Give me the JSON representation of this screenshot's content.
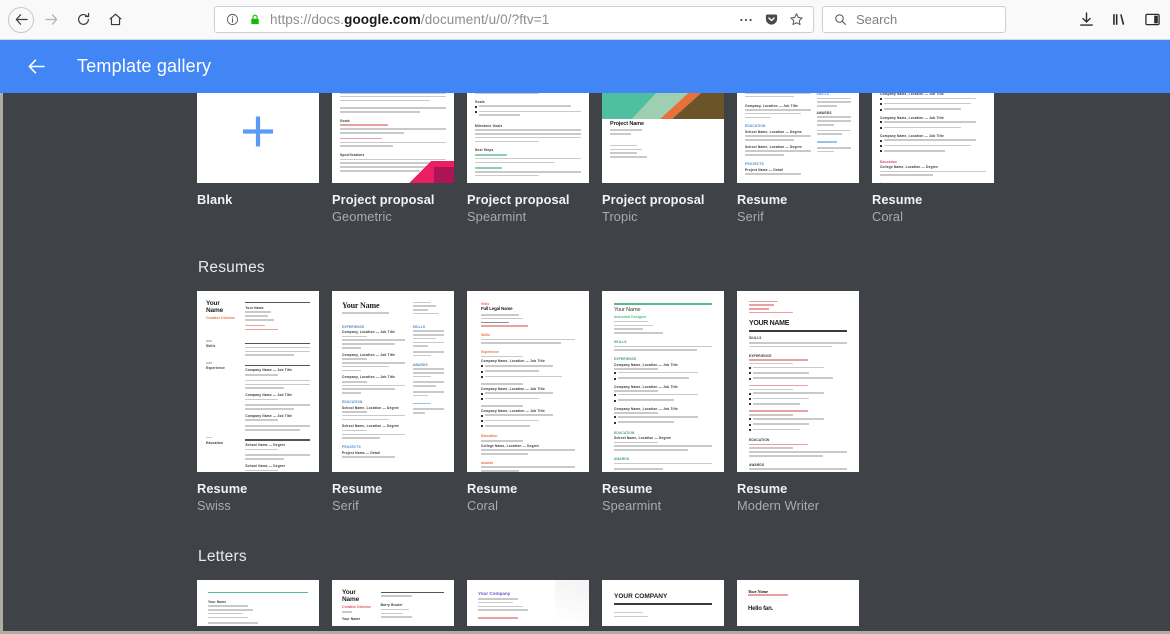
{
  "browser": {
    "nav": {
      "back_icon": "arrow-left-icon",
      "forward_icon": "arrow-right-icon",
      "reload_icon": "reload-icon",
      "home_icon": "home-icon"
    },
    "url": {
      "scheme": "https://",
      "prefix": "docs.",
      "host": "google.com",
      "path": "/document/u/0/?ftv=1",
      "full": "https://docs.google.com/document/u/0/?ftv=1",
      "info_icon": "page-info-icon",
      "lock_icon": "lock-icon",
      "page_actions_icon": "ellipsis-icon",
      "pocket_icon": "pocket-icon",
      "bookmark_icon": "star-icon"
    },
    "search": {
      "placeholder": "Search",
      "icon": "search-icon"
    },
    "toolbar_right": {
      "downloads_icon": "download-icon",
      "library_icon": "library-icon",
      "sidebar_icon": "sidebar-icon"
    }
  },
  "app_header": {
    "back_icon": "arrow-left-icon",
    "title": "Template gallery",
    "accent_color": "#4285f4"
  },
  "gallery": {
    "background_color": "#3f4348",
    "rows": [
      {
        "section": null,
        "cards": [
          {
            "title": "Blank",
            "subtitle": "",
            "style": "blank"
          },
          {
            "title": "Project proposal",
            "subtitle": "Geometric",
            "style": "geometric"
          },
          {
            "title": "Project proposal",
            "subtitle": "Spearmint",
            "style": "proposal-spearmint"
          },
          {
            "title": "Project proposal",
            "subtitle": "Tropic",
            "style": "tropic"
          },
          {
            "title": "Resume",
            "subtitle": "Serif",
            "style": "resume-serif-top"
          },
          {
            "title": "Resume",
            "subtitle": "Coral",
            "style": "resume-coral-top"
          }
        ]
      },
      {
        "section": "Resumes",
        "cards": [
          {
            "title": "Resume",
            "subtitle": "Swiss",
            "style": "swiss",
            "name": "Your Name",
            "role": "Creative Director"
          },
          {
            "title": "Resume",
            "subtitle": "Serif",
            "style": "serif",
            "name": "Your Name",
            "role": ""
          },
          {
            "title": "Resume",
            "subtitle": "Coral",
            "style": "coral",
            "name": "Full Legal Name",
            "role": "Hello"
          },
          {
            "title": "Resume",
            "subtitle": "Spearmint",
            "style": "spearmint",
            "name": "Your Name",
            "role": "Industrial Designer"
          },
          {
            "title": "Resume",
            "subtitle": "Modern Writer",
            "style": "modern",
            "name": "YOUR NAME",
            "role": ""
          }
        ]
      },
      {
        "section": "Letters",
        "cards": [
          {
            "title": "",
            "subtitle": "",
            "style": "letter-mint",
            "name": "Your Name"
          },
          {
            "title": "",
            "subtitle": "",
            "style": "letter-swiss",
            "name": "Your Name",
            "role": "Creative Director"
          },
          {
            "title": "",
            "subtitle": "",
            "style": "letter-plum",
            "name": "Your Company"
          },
          {
            "title": "",
            "subtitle": "",
            "style": "letter-company",
            "name": "YOUR COMPANY"
          },
          {
            "title": "",
            "subtitle": "",
            "style": "letter-fan",
            "name": "Your Name",
            "role": "Hello fan."
          }
        ]
      }
    ],
    "section_titles": {
      "resumes": "Resumes",
      "letters": "Letters"
    },
    "thumb_text": {
      "project_name": "Project Name",
      "hello_fan": "Hello fan.",
      "your_company_caps": "YOUR COMPANY",
      "your_company": "Your Company",
      "your_name": "Your Name",
      "your_name_caps": "YOUR NAME",
      "creative_director": "Creative Director",
      "industrial_designer": "Industrial Designer",
      "full_legal_name": "Full Legal Name",
      "hello": "Hello",
      "barry_bruder": "Barry Bruder"
    }
  }
}
